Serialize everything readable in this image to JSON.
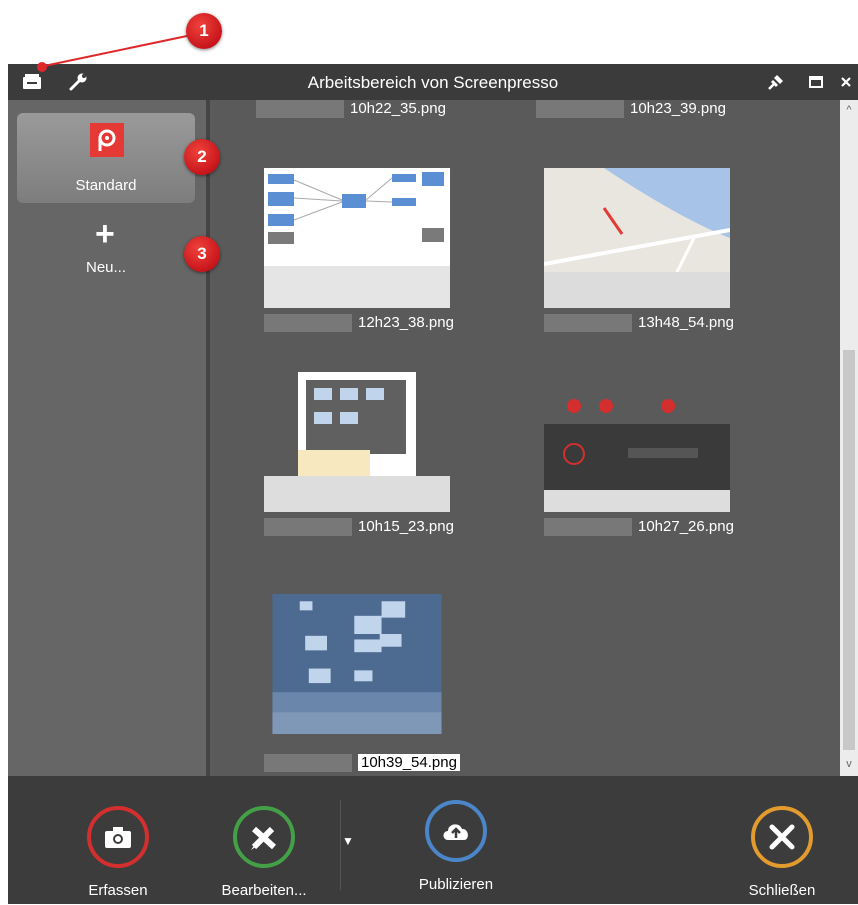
{
  "window": {
    "title": "Arbeitsbereich von Screenpresso"
  },
  "callouts": [
    "1",
    "2",
    "3"
  ],
  "sidebar": {
    "profile_label": "Standard",
    "new_label": "Neu..."
  },
  "gallery": {
    "top_captions": [
      "10h22_35.png",
      "10h23_39.png"
    ],
    "items": [
      {
        "file": "12h23_38.png"
      },
      {
        "file": "13h48_54.png"
      },
      {
        "file": "10h15_23.png"
      },
      {
        "file": "10h27_26.png"
      },
      {
        "file": "10h39_54.png"
      }
    ]
  },
  "footer": {
    "capture": "Erfassen",
    "edit": "Bearbeiten...",
    "publish": "Publizieren",
    "close": "Schließen"
  },
  "colors": {
    "capture_ring": "#d32f2f",
    "edit_ring": "#43a047",
    "publish_ring": "#4a86c8",
    "close_ring": "#e39b2e"
  }
}
